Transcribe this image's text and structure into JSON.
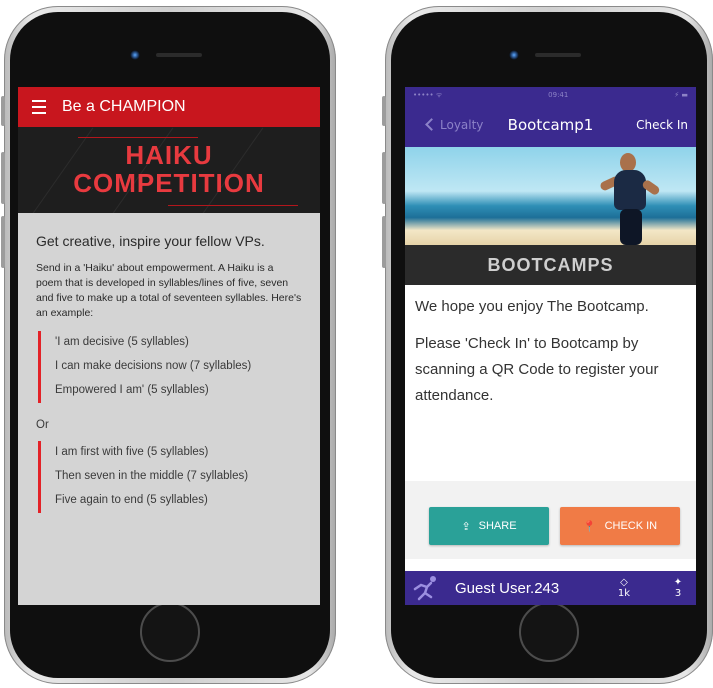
{
  "left_phone": {
    "app_title": "Be a CHAMPION",
    "banner": {
      "line1": "HAIKU",
      "line2": "COMPETITION"
    },
    "heading": "Get creative, inspire your fellow VPs.",
    "intro": "Send in a 'Haiku' about empowerment. A Haiku is a poem that is developed in syllables/lines of five, seven and five to make up a total of seventeen syllables. Here's an example:",
    "poem1": [
      "'I am decisive (5 syllables)",
      "I can make decisions now (7 syllables)",
      "Empowered I am' (5 syllables)"
    ],
    "or_text": "Or",
    "poem2": [
      "I am first with five (5 syllables)",
      "Then seven in the middle (7 syllables)",
      "Five again to end (5 syllables)"
    ],
    "colors": {
      "appbar": "#c8161e",
      "accent": "#e32228",
      "background": "#d4d4d4"
    }
  },
  "right_phone": {
    "status_time": "09:41",
    "status_carrier": "••••• ᯤ",
    "status_battery": "⚡ ▬",
    "nav": {
      "back_label": "Loyalty",
      "title": "Bootcamp1",
      "action_label": "Check In"
    },
    "banner_text": "BOOTCAMPS",
    "paragraph1": "We hope you enjoy The Bootcamp.",
    "paragraph2": "Please 'Check In' to Bootcamp  by scanning a QR Code to register your attendance.",
    "buttons": {
      "share_label": "SHARE",
      "checkin_label": "CHECK IN"
    },
    "footer": {
      "user_name": "Guest User.243",
      "points_value": "1k",
      "badges_value": "3"
    },
    "colors": {
      "primary": "#3b2a8f",
      "share": "#2aa198",
      "checkin": "#f07b46"
    }
  }
}
